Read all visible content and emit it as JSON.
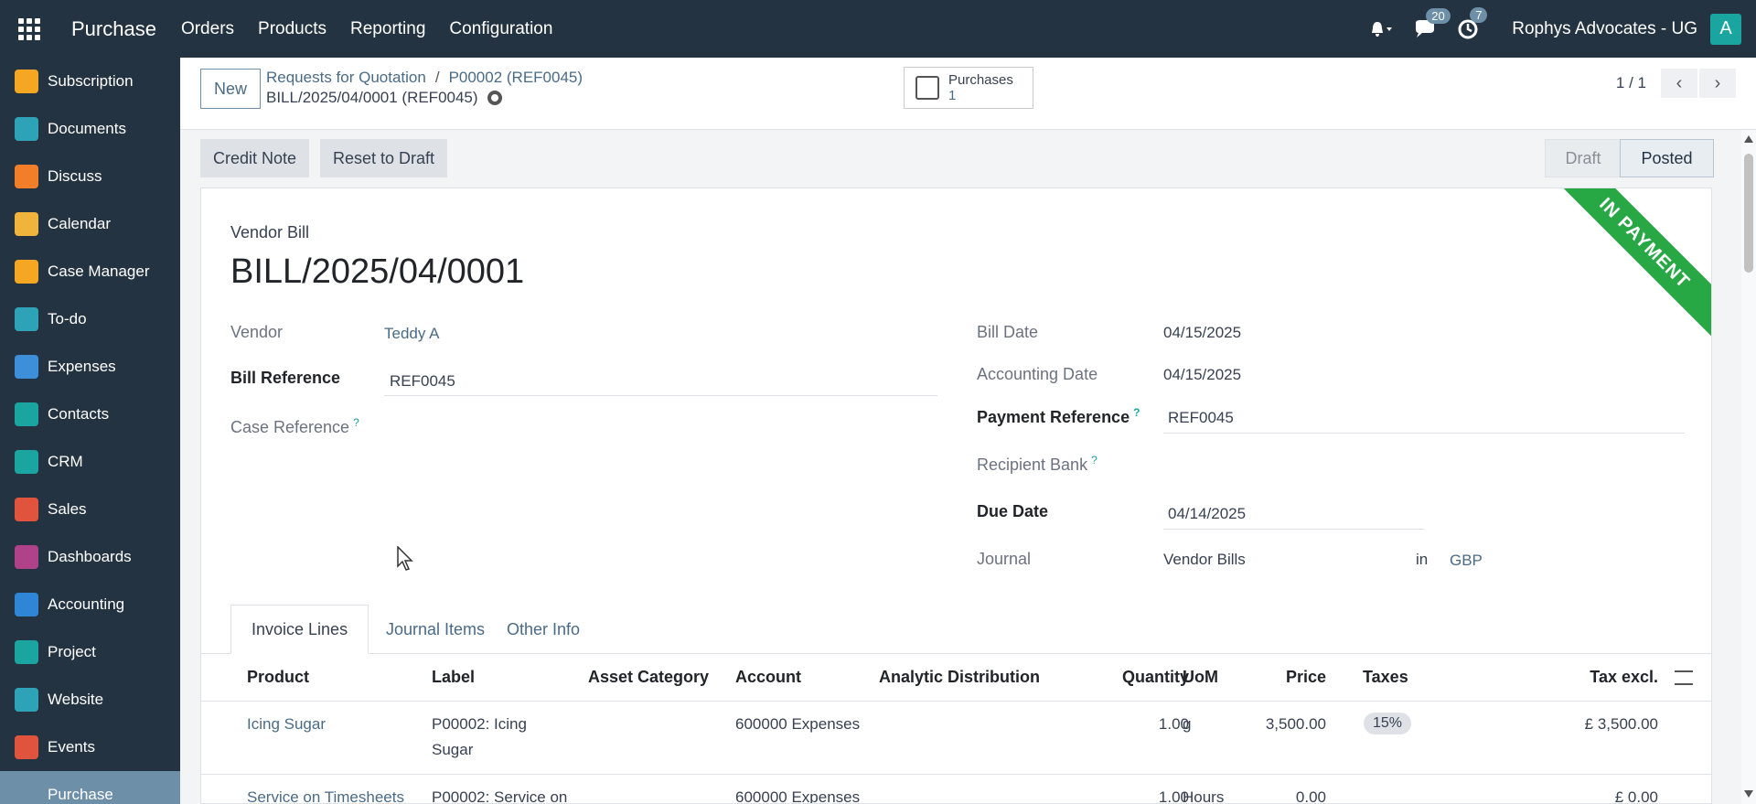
{
  "topbar": {
    "app_name": "Purchase",
    "menu": [
      "Orders",
      "Products",
      "Reporting",
      "Configuration"
    ],
    "messages_count": "20",
    "activities_count": "7",
    "company": "Rophys Advocates - UG",
    "avatar_letter": "A"
  },
  "sidebar": {
    "items": [
      {
        "label": "Subscription",
        "icon": "subscription-icon",
        "color": "#f5a623"
      },
      {
        "label": "Documents",
        "icon": "documents-icon",
        "color": "#2ea3b8"
      },
      {
        "label": "Discuss",
        "icon": "discuss-icon",
        "color": "#f27e2a"
      },
      {
        "label": "Calendar",
        "icon": "calendar-icon",
        "color": "#f0b43c"
      },
      {
        "label": "Case Manager",
        "icon": "case-manager-icon",
        "color": "#f5a623"
      },
      {
        "label": "To-do",
        "icon": "todo-icon",
        "color": "#2ea3b8"
      },
      {
        "label": "Expenses",
        "icon": "expenses-icon",
        "color": "#3d8fd9"
      },
      {
        "label": "Contacts",
        "icon": "contacts-icon",
        "color": "#1aa5a0"
      },
      {
        "label": "CRM",
        "icon": "crm-icon",
        "color": "#1aa5a0"
      },
      {
        "label": "Sales",
        "icon": "sales-icon",
        "color": "#e0533c"
      },
      {
        "label": "Dashboards",
        "icon": "dashboards-icon",
        "color": "#b0428a"
      },
      {
        "label": "Accounting",
        "icon": "accounting-icon",
        "color": "#2f86d6"
      },
      {
        "label": "Project",
        "icon": "project-icon",
        "color": "#1aa5a0"
      },
      {
        "label": "Website",
        "icon": "website-icon",
        "color": "#2ea3b8"
      },
      {
        "label": "Events",
        "icon": "events-icon",
        "color": "#e0533c"
      },
      {
        "label": "Purchase",
        "icon": "purchase-icon",
        "color": "#6d8fa8",
        "active": true
      }
    ]
  },
  "control": {
    "new_label": "New",
    "breadcrumb_parent": "Requests for Quotation",
    "breadcrumb_child": "P00002 (REF0045)",
    "record_title": "BILL/2025/04/0001 (REF0045)",
    "smart_button_label": "Purchases",
    "smart_button_count": "1",
    "pager": "1 / 1"
  },
  "statusbar": {
    "credit_note": "Credit Note",
    "reset_to_draft": "Reset to Draft",
    "stage_draft": "Draft",
    "stage_posted": "Posted"
  },
  "form": {
    "ribbon": "IN PAYMENT",
    "doc_type": "Vendor Bill",
    "doc_name": "BILL/2025/04/0001",
    "vendor_label": "Vendor",
    "vendor_value": "Teddy A",
    "bill_reference_label": "Bill Reference",
    "bill_reference_value": "REF0045",
    "case_reference_label": "Case Reference",
    "bill_date_label": "Bill Date",
    "bill_date_value": "04/15/2025",
    "accounting_date_label": "Accounting Date",
    "accounting_date_value": "04/15/2025",
    "payment_reference_label": "Payment Reference",
    "payment_reference_value": "REF0045",
    "recipient_bank_label": "Recipient Bank",
    "due_date_label": "Due Date",
    "due_date_value": "04/14/2025",
    "journal_label": "Journal",
    "journal_value": "Vendor Bills",
    "journal_in": "in",
    "currency": "GBP",
    "help_mark": "?"
  },
  "tabs": [
    "Invoice Lines",
    "Journal Items",
    "Other Info"
  ],
  "table": {
    "headers": [
      "Product",
      "Label",
      "Asset Category",
      "Account",
      "Analytic Distribution",
      "Quantity",
      "UoM",
      "Price",
      "Taxes",
      "Tax excl."
    ],
    "rows": [
      {
        "product": "Icing Sugar",
        "label_line1": "P00002: Icing",
        "label_line2": "Sugar",
        "account": "600000 Expenses",
        "quantity": "1.00",
        "uom": "g",
        "price": "3,500.00",
        "tax": "15%",
        "subtotal": "£ 3,500.00"
      },
      {
        "product": "Service on Timesheets",
        "label_line1": "P00002: Service on",
        "account": "600000 Expenses",
        "quantity": "1.00",
        "uom": "Hours",
        "price": "0.00",
        "subtotal": "£ 0.00"
      }
    ]
  }
}
